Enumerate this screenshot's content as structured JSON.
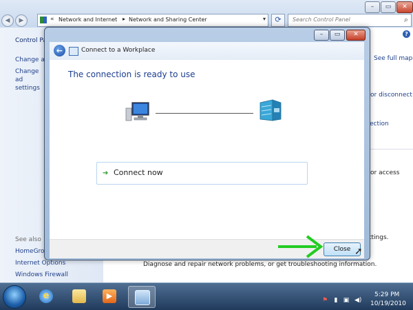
{
  "explorer": {
    "address": {
      "chevron": "«",
      "crumbs": [
        "Network and Internet",
        "Network and Sharing Center"
      ],
      "separator": "▸",
      "dropdown": "▾"
    },
    "search_placeholder": "Search Control Panel",
    "sidebar": {
      "home": "Control Pa",
      "change_adapter": "Change ad",
      "change_advanced": "Change ad settings",
      "see_also": "See also",
      "homegroup": "HomeGrou",
      "internet_options": "Internet Options",
      "windows_firewall": "Windows Firewall"
    },
    "right_fragments": {
      "see_full_map": "See full map",
      "or_disconnect": "or disconnect",
      "ection": "ection",
      "or_access": "or access",
      "settings": "ttings.",
      "diagnose": "Diagnose and repair network problems, or get troubleshooting information."
    },
    "help_label": "?"
  },
  "dialog": {
    "title": "Connect to a Workplace",
    "heading": "The connection is ready to use",
    "option_arrow": "➔",
    "connect_now": "Connect now",
    "close_button": "Close",
    "min_symbol": "–",
    "max_symbol": "▭",
    "close_symbol": "✕"
  },
  "taskbar": {
    "time": "5:29 PM",
    "date": "10/19/2010"
  },
  "colors": {
    "accent_heading": "#1c3d8f",
    "link": "#1e3f8a",
    "annotation_arrow": "#22cc22"
  }
}
